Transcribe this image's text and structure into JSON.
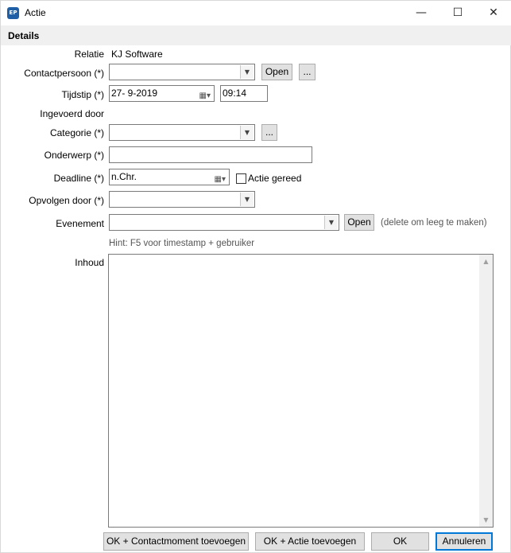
{
  "window": {
    "icon_text": "EP",
    "title": "Actie",
    "minimize": "—",
    "maximize": "☐",
    "close": "✕"
  },
  "section": {
    "title": "Details"
  },
  "fields": {
    "relatie_label": "Relatie",
    "relatie_value": "KJ Software",
    "contactpersoon_label": "Contactpersoon (*)",
    "contactpersoon_value": "",
    "open_label": "Open",
    "more_label": "...",
    "tijdstip_label": "Tijdstip (*)",
    "tijdstip_date": "27-  9-2019",
    "tijdstip_time": "09:14",
    "ingevoerd_label": "Ingevoerd door",
    "categorie_label": "Categorie (*)",
    "categorie_value": "",
    "onderwerp_label": "Onderwerp (*)",
    "onderwerp_value": "",
    "deadline_label": "Deadline (*)",
    "deadline_value": "n.Chr.",
    "actie_gereed_label": "Actie gereed",
    "actie_gereed_checked": false,
    "opvolgen_label": "Opvolgen door (*)",
    "opvolgen_value": "",
    "evenement_label": "Evenement",
    "evenement_value": "",
    "evenement_open": "Open",
    "evenement_hint": "(delete om leeg te maken)",
    "hint": "Hint: F5 voor timestamp + gebruiker",
    "inhoud_label": "Inhoud",
    "inhoud_value": ""
  },
  "buttons": {
    "ok_contact": "OK + Contactmoment toevoegen",
    "ok_actie": "OK + Actie toevoegen",
    "ok": "OK",
    "annuleren": "Annuleren"
  }
}
